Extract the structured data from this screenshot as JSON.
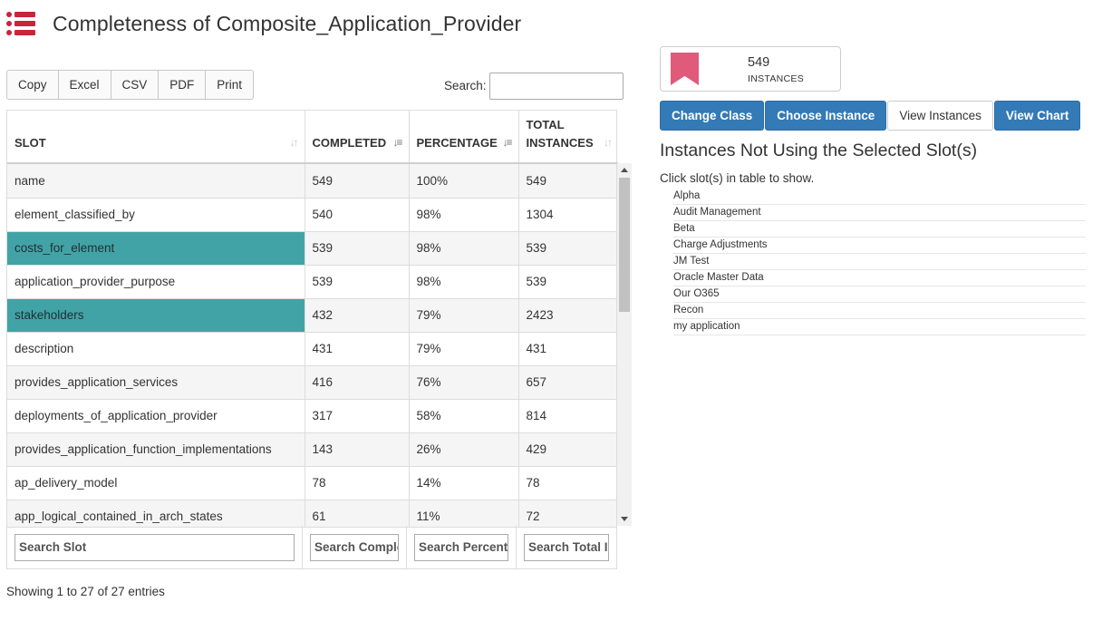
{
  "page": {
    "title": "Completeness of Composite_Application_Provider",
    "icon": "list-icon",
    "accent_color": "#c8243a"
  },
  "toolbar": {
    "buttons": [
      "Copy",
      "Excel",
      "CSV",
      "PDF",
      "Print"
    ],
    "search_label": "Search:",
    "search_value": ""
  },
  "table": {
    "columns": [
      {
        "label": "SLOT",
        "sort": "none"
      },
      {
        "label": "COMPLETED",
        "sort": "desc"
      },
      {
        "label": "PERCENTAGE",
        "sort": "desc"
      },
      {
        "label": "TOTAL INSTANCES",
        "sort": "none"
      }
    ],
    "rows": [
      {
        "slot": "name",
        "completed": "549",
        "percentage": "100%",
        "total": "549",
        "selected": false
      },
      {
        "slot": "element_classified_by",
        "completed": "540",
        "percentage": "98%",
        "total": "1304",
        "selected": false
      },
      {
        "slot": "costs_for_element",
        "completed": "539",
        "percentage": "98%",
        "total": "539",
        "selected": true
      },
      {
        "slot": "application_provider_purpose",
        "completed": "539",
        "percentage": "98%",
        "total": "539",
        "selected": false
      },
      {
        "slot": "stakeholders",
        "completed": "432",
        "percentage": "79%",
        "total": "2423",
        "selected": true
      },
      {
        "slot": "description",
        "completed": "431",
        "percentage": "79%",
        "total": "431",
        "selected": false
      },
      {
        "slot": "provides_application_services",
        "completed": "416",
        "percentage": "76%",
        "total": "657",
        "selected": false
      },
      {
        "slot": "deployments_of_application_provider",
        "completed": "317",
        "percentage": "58%",
        "total": "814",
        "selected": false
      },
      {
        "slot": "provides_application_function_implementations",
        "completed": "143",
        "percentage": "26%",
        "total": "429",
        "selected": false
      },
      {
        "slot": "ap_delivery_model",
        "completed": "78",
        "percentage": "14%",
        "total": "78",
        "selected": false
      },
      {
        "slot": "app_logical_contained_in_arch_states",
        "completed": "61",
        "percentage": "11%",
        "total": "72",
        "selected": false
      }
    ],
    "footer_filters": [
      "Search Slot",
      "Search Complé",
      "Search Percent",
      "Search Total I"
    ],
    "info": "Showing 1 to 27 of 27 entries",
    "selected_color": "#42a3a7"
  },
  "summary": {
    "count": "549",
    "count_label": "INSTANCES",
    "icon": "bookmark-icon",
    "icon_color": "#e05a7a"
  },
  "actions": {
    "buttons": [
      {
        "label": "Change Class",
        "style": "primary"
      },
      {
        "label": "Choose Instance",
        "style": "primary"
      },
      {
        "label": "View Instances",
        "style": "default"
      },
      {
        "label": "View Chart",
        "style": "primary"
      }
    ],
    "primary_color": "#337ab7"
  },
  "panel": {
    "title": "Instances Not Using the Selected Slot(s)",
    "help": "Click slot(s) in table to show.",
    "instances": [
      "Alpha",
      "Audit Management",
      "Beta",
      "Charge Adjustments",
      "JM Test",
      "Oracle Master Data",
      "Our O365",
      "Recon",
      "my application"
    ]
  }
}
